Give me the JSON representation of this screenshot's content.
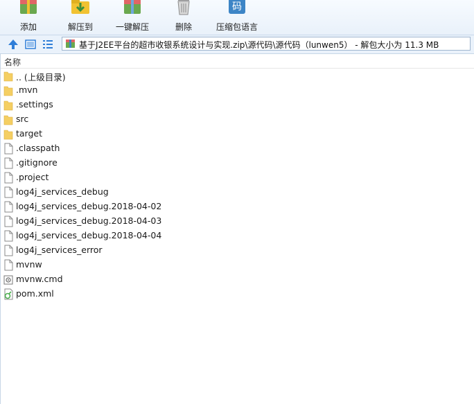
{
  "toolbar": {
    "buttons": [
      {
        "label": "添加",
        "icon": "add-archive-icon"
      },
      {
        "label": "解压到",
        "icon": "extract-to-icon"
      },
      {
        "label": "一键解压",
        "icon": "one-click-extract-icon"
      },
      {
        "label": "删除",
        "icon": "delete-trash-icon"
      },
      {
        "label": "压缩包语言",
        "icon": "archive-language-icon"
      }
    ],
    "language_icon_glyph": "码"
  },
  "address_bar": {
    "path": "基于J2EE平台的超市收银系统设计与实现.zip\\源代码\\源代码（lunwen5） - 解包大小为 11.3 MB"
  },
  "list": {
    "column_name": "名称",
    "files": [
      {
        "name": ".. (上级目录)",
        "type": "folder"
      },
      {
        "name": ".mvn",
        "type": "folder"
      },
      {
        "name": ".settings",
        "type": "folder"
      },
      {
        "name": "src",
        "type": "folder"
      },
      {
        "name": "target",
        "type": "folder"
      },
      {
        "name": ".classpath",
        "type": "file"
      },
      {
        "name": ".gitignore",
        "type": "file"
      },
      {
        "name": ".project",
        "type": "file"
      },
      {
        "name": "log4j_services_debug",
        "type": "file"
      },
      {
        "name": "log4j_services_debug.2018-04-02",
        "type": "file"
      },
      {
        "name": "log4j_services_debug.2018-04-03",
        "type": "file"
      },
      {
        "name": "log4j_services_debug.2018-04-04",
        "type": "file"
      },
      {
        "name": "log4j_services_error",
        "type": "file"
      },
      {
        "name": "mvnw",
        "type": "file"
      },
      {
        "name": "mvnw.cmd",
        "type": "cmd"
      },
      {
        "name": "pom.xml",
        "type": "xml"
      }
    ]
  },
  "colors": {
    "folder": "#f5cf63",
    "accent": "#2f7ed8",
    "toolbar_bg": "#eef4fb"
  }
}
